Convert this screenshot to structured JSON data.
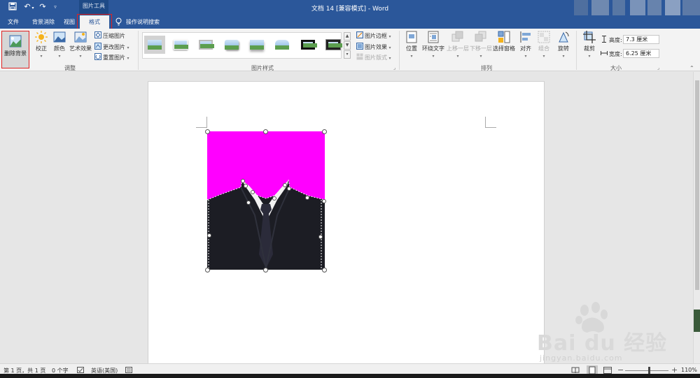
{
  "window": {
    "title": "文档 14 [兼容模式]  -  Word",
    "picture_tools_label": "图片工具",
    "title_bar_color": "#2b579a"
  },
  "quick_access": {
    "icons": [
      "save-icon",
      "undo-icon",
      "redo-icon",
      "customize-icon"
    ]
  },
  "tabs": [
    {
      "label": "文件"
    },
    {
      "label": "背景消除"
    },
    {
      "label": "视图"
    },
    {
      "label": "格式",
      "active": true
    }
  ],
  "tell_me": {
    "label": "操作说明搜索"
  },
  "ribbon": {
    "adjust_group": {
      "label": "调整",
      "remove_background": "删除背景",
      "corrections": "校正",
      "color": "颜色",
      "artistic_effects": "艺术效果",
      "compress": "压缩图片",
      "change": "更改图片",
      "reset": "重置图片"
    },
    "styles_group": {
      "label": "图片样式",
      "border": "图片边框",
      "effects": "图片效果",
      "layout": "图片版式"
    },
    "arrange_group": {
      "label": "排列",
      "position": "位置",
      "wrap_text": "环绕文字",
      "bring_forward": "上移一层",
      "send_backward": "下移一层",
      "selection_pane": "选择窗格",
      "align": "对齐",
      "group": "组合",
      "rotate": "旋转"
    },
    "size_group": {
      "label": "大小",
      "crop": "裁剪",
      "height_label": "高度:",
      "height_value": "7.3 厘米",
      "width_label": "宽度:",
      "width_value": "6.25 厘米"
    }
  },
  "picture": {
    "background_color": "#ff00ff",
    "suit_color": "#1c1d24"
  },
  "status": {
    "page": "第 1 页，共 1 页",
    "words": "0 个字",
    "language": "英语(美国)",
    "zoom": "110%"
  },
  "watermark": {
    "brand": "Bai du 经验",
    "url": "jingyan.baidu.com"
  }
}
